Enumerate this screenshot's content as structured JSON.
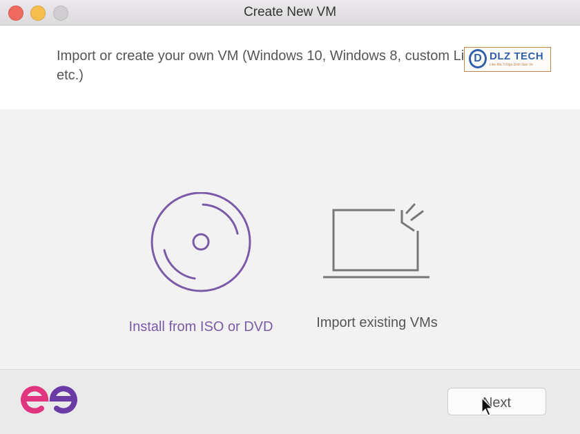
{
  "window": {
    "title": "Create New VM",
    "traffic_lights": [
      "close",
      "minimize",
      "zoom"
    ]
  },
  "header": {
    "description": "Import or create your own VM (Windows 10, Windows 8, custom Linux, etc.)"
  },
  "watermark": {
    "letter": "D",
    "text": "DLZ TECH",
    "subtext": "Like Ma Ti Nga Dinh Nan Ve"
  },
  "options": [
    {
      "label": "Install from ISO or DVD",
      "icon": "disc-icon",
      "selected": true
    },
    {
      "label": "Import existing VMs",
      "icon": "laptop-import-icon",
      "selected": false
    }
  ],
  "footer": {
    "brand_icon": "ee-logo-icon",
    "next_label": "Next"
  },
  "colors": {
    "accent": "#7a5aa6",
    "brand_pink": "#e0357f",
    "brand_purple": "#6a3aa5"
  }
}
